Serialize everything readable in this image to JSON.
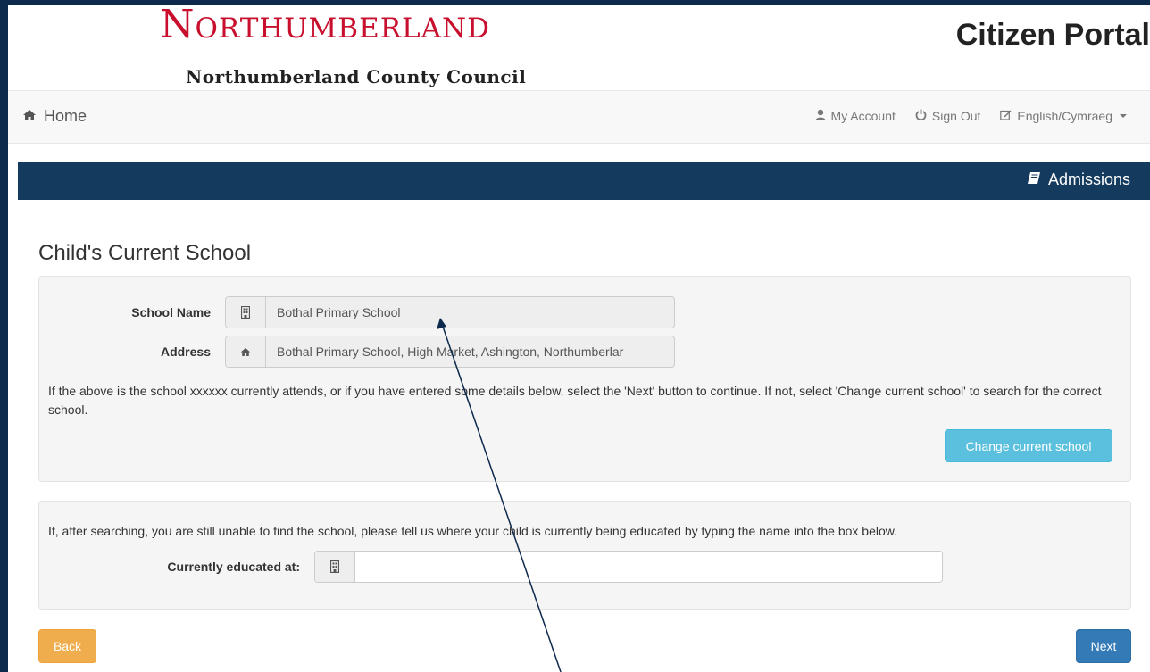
{
  "header": {
    "logo_text": "Northumberland",
    "logo_subtitle": "Northumberland County Council",
    "portal_title": "Citizen Portal"
  },
  "navbar": {
    "home_label": "Home",
    "my_account_label": "My Account",
    "sign_out_label": "Sign Out",
    "language_label": "English/Cymraeg"
  },
  "service": {
    "title": "Admissions"
  },
  "page": {
    "heading": "Child's Current School"
  },
  "current_school": {
    "school_name_label": "School Name",
    "school_name_value": "Bothal Primary School",
    "address_label": "Address",
    "address_value": "Bothal Primary School, High Market, Ashington, Northumberlar",
    "info_text": "If the above is the school xxxxxx currently attends, or if you have entered some details below, select the 'Next' button to continue. If not, select 'Change current school' to search for the correct school.",
    "change_button_label": "Change current school"
  },
  "manual_entry": {
    "info_text": "If, after searching, you are still unable to find the school, please tell us where your child is currently being educated by typing the name into the box below.",
    "currently_educated_label": "Currently educated at:",
    "currently_educated_value": ""
  },
  "actions": {
    "back_label": "Back",
    "next_label": "Next"
  },
  "colors": {
    "brand_red": "#c8102e",
    "service_bar": "#143a5e",
    "info_button": "#5bc0de",
    "warning_button": "#f0ad4e",
    "primary_button": "#337ab7"
  }
}
